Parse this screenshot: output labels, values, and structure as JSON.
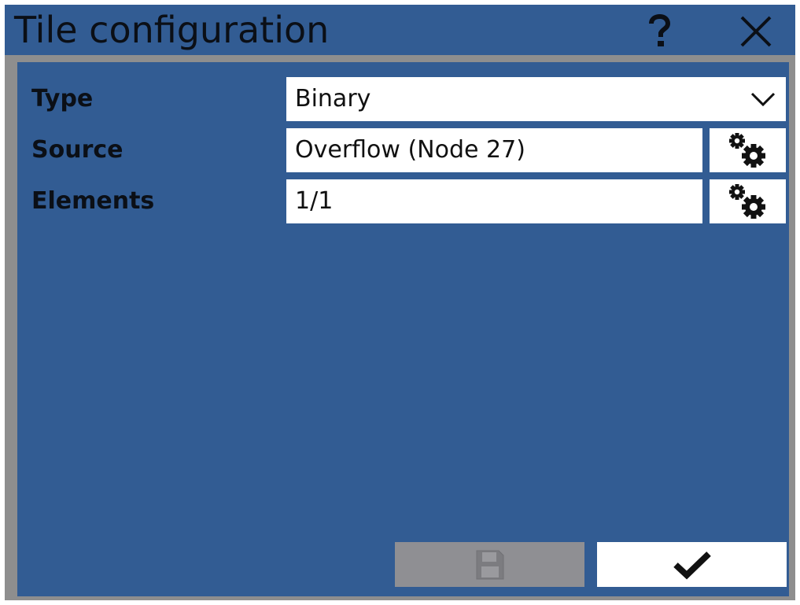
{
  "window": {
    "title": "Tile configuration",
    "help_icon": "question-mark-icon",
    "close_icon": "close-x-icon"
  },
  "form": {
    "type": {
      "label": "Type",
      "value": "Binary",
      "icon": "chevron-down-icon"
    },
    "source": {
      "label": "Source",
      "value": "Overflow (Node 27)",
      "icon": "gears-icon"
    },
    "elements": {
      "label": "Elements",
      "value": "1/1",
      "icon": "gears-icon"
    }
  },
  "footer": {
    "save_icon": "floppy-disk-icon",
    "save_enabled": false,
    "confirm_icon": "checkmark-icon"
  },
  "colors": {
    "title_bar": "#325c93",
    "content_bg": "#325c93",
    "frame": "#8e8e8e",
    "disabled_button": "#8f8f93",
    "field_bg": "#ffffff",
    "text": "#0b0f16"
  }
}
